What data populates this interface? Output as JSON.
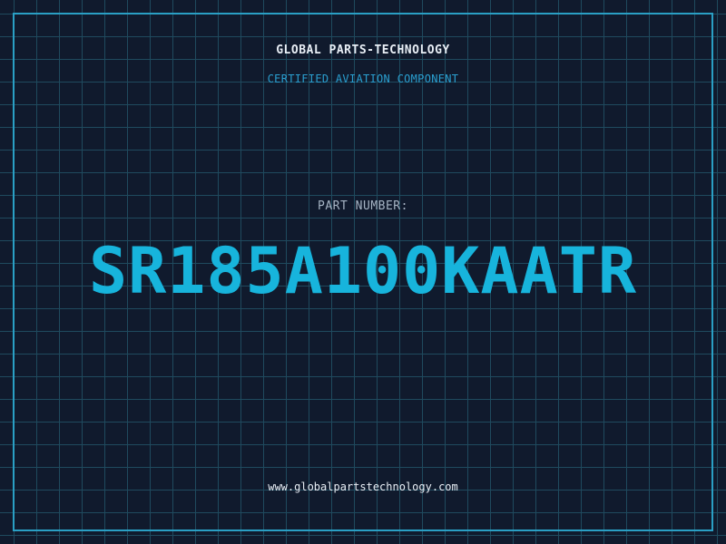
{
  "header": {
    "company_name": "GLOBAL PARTS-TECHNOLOGY",
    "subtitle": "CERTIFIED AVIATION COMPONENT"
  },
  "part": {
    "label": "PART NUMBER:",
    "number": "SR185A100KAATR"
  },
  "footer": {
    "website": "www.globalpartstechnology.com"
  },
  "colors": {
    "background": "#101a2d",
    "grid": "#1f4a5e",
    "frame": "#2a9fc4",
    "accent": "#17b4dc",
    "text": "#e8eef5",
    "muted": "#a6b4c4"
  }
}
